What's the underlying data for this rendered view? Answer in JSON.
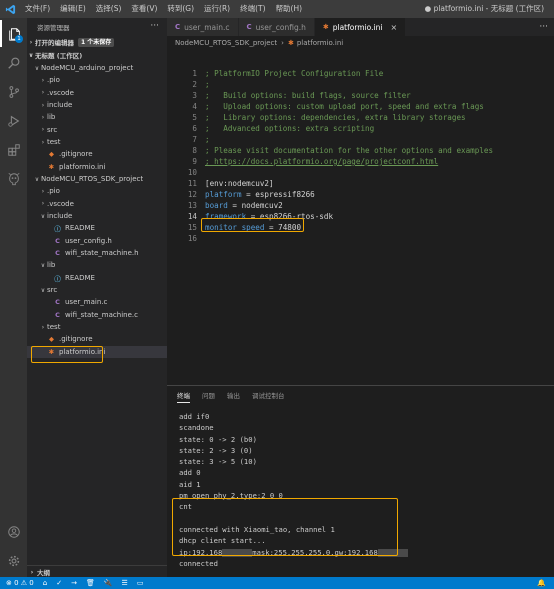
{
  "titlebar": {
    "menus": [
      "文件(F)",
      "编辑(E)",
      "选择(S)",
      "查看(V)",
      "转到(G)",
      "运行(R)",
      "终端(T)",
      "帮助(H)"
    ],
    "window_title": "● platformio.ini - 无标题 (工作区)"
  },
  "activitybar": {
    "explorer_badge": "1"
  },
  "sidebar": {
    "header": "资源管理器",
    "more": "···",
    "open_editors": "打开的编辑器",
    "unsaved_badge": "1 个未保存",
    "workspace": "无标题 (工作区)",
    "rows": [
      {
        "chev": "∨",
        "icon": "",
        "label": "NodeMCU_arduino_project",
        "indent": 6
      },
      {
        "chev": "›",
        "icon": "",
        "label": ".pio",
        "indent": 12
      },
      {
        "chev": "›",
        "icon": "",
        "label": ".vscode",
        "indent": 12
      },
      {
        "chev": "›",
        "icon": "",
        "label": "include",
        "indent": 12
      },
      {
        "chev": "›",
        "icon": "",
        "label": "lib",
        "indent": 12
      },
      {
        "chev": "›",
        "icon": "",
        "label": "src",
        "indent": 12
      },
      {
        "chev": "›",
        "icon": "",
        "label": "test",
        "indent": 12
      },
      {
        "chev": "",
        "icon": "◆",
        "label": ".gitignore",
        "indent": 12
      },
      {
        "chev": "",
        "icon": "✱",
        "label": "platformio.ini",
        "indent": 12
      },
      {
        "chev": "∨",
        "icon": "",
        "label": "NodeMCU_RTOS_SDK_project",
        "indent": 6
      },
      {
        "chev": "›",
        "icon": "",
        "label": ".pio",
        "indent": 12
      },
      {
        "chev": "›",
        "icon": "",
        "label": ".vscode",
        "indent": 12
      },
      {
        "chev": "∨",
        "icon": "",
        "label": "include",
        "indent": 12
      },
      {
        "chev": "",
        "icon": "ⓘ",
        "label": "README",
        "indent": 18
      },
      {
        "chev": "",
        "icon": "C",
        "label": "user_config.h",
        "indent": 18
      },
      {
        "chev": "",
        "icon": "C",
        "label": "wifi_state_machine.h",
        "indent": 18
      },
      {
        "chev": "∨",
        "icon": "",
        "label": "lib",
        "indent": 12
      },
      {
        "chev": "",
        "icon": "ⓘ",
        "label": "README",
        "indent": 18
      },
      {
        "chev": "∨",
        "icon": "",
        "label": "src",
        "indent": 12
      },
      {
        "chev": "",
        "icon": "C",
        "label": "user_main.c",
        "indent": 18
      },
      {
        "chev": "",
        "icon": "C",
        "label": "wifi_state_machine.c",
        "indent": 18
      },
      {
        "chev": "›",
        "icon": "",
        "label": "test",
        "indent": 12
      },
      {
        "chev": "",
        "icon": "◆",
        "label": ".gitignore",
        "indent": 12
      },
      {
        "chev": "",
        "icon": "✱",
        "label": "platformio.ini",
        "indent": 12
      }
    ],
    "outline": "大纲"
  },
  "tabs": [
    {
      "icon": "C",
      "label": "user_main.c",
      "active": false
    },
    {
      "icon": "C",
      "label": "user_config.h",
      "active": false
    },
    {
      "icon": "✱",
      "label": "platformio.ini",
      "active": true
    }
  ],
  "breadcrumb": [
    "NodeMCU_RTOS_SDK_project",
    "platformio.ini"
  ],
  "editor": {
    "lines": [
      {
        "n": "1",
        "t": "; PlatformIO Project Configuration File",
        "k": "comment"
      },
      {
        "n": "2",
        "t": ";",
        "k": "comment"
      },
      {
        "n": "3",
        "t": ";   Build options: build flags, source filter",
        "k": "comment"
      },
      {
        "n": "4",
        "t": ";   Upload options: custom upload port, speed and extra flags",
        "k": "comment"
      },
      {
        "n": "5",
        "t": ";   Library options: dependencies, extra library storages",
        "k": "comment"
      },
      {
        "n": "6",
        "t": ";   Advanced options: extra scripting",
        "k": "comment"
      },
      {
        "n": "7",
        "t": ";",
        "k": "comment"
      },
      {
        "n": "8",
        "t": "; Please visit documentation for the other options and examples",
        "k": "comment"
      },
      {
        "n": "9",
        "t": "; https://docs.platformio.org/page/projectconf.html",
        "k": "link"
      },
      {
        "n": "10",
        "t": "",
        "k": "plain"
      },
      {
        "n": "11",
        "t": "[env:nodemcuv2]",
        "k": "section"
      },
      {
        "n": "12",
        "key": "platform",
        "val": " = espressif8266",
        "k": "kv"
      },
      {
        "n": "13",
        "key": "board",
        "val": " = nodemcuv2",
        "k": "kv"
      },
      {
        "n": "14",
        "key": "framework",
        "val": " = esp8266-rtos-sdk",
        "k": "kv"
      },
      {
        "n": "15",
        "key": "monitor_speed",
        "val": " = 74800",
        "k": "kv"
      },
      {
        "n": "16",
        "t": "",
        "k": "plain"
      }
    ]
  },
  "panel": {
    "tabs": [
      "终端",
      "问题",
      "输出",
      "调试控制台"
    ],
    "terminal": [
      "add if0",
      "scandone",
      "state: 0 -> 2 (b0)",
      "state: 2 -> 3 (0)",
      "state: 3 -> 5 (10)",
      "add 0",
      "aid 1",
      "pm open phy_2,type:2 0 0",
      "cnt",
      "",
      "connected with Xiaomi_tao, channel 1",
      "dhcp client start...",
      "ip:192.168",
      "connected"
    ],
    "ip_mid": "mask:255.255.255.0,gw:192.168"
  },
  "statusbar": {
    "items": [
      "⊗ 0 ⚠ 0",
      "⌂",
      "✓",
      "→",
      "🗑",
      "🔌",
      "☰",
      "▭"
    ],
    "right": "🔔"
  }
}
